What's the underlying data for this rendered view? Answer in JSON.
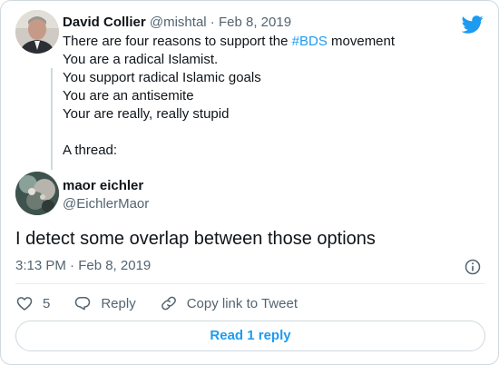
{
  "parent_tweet": {
    "author_name": "David Collier",
    "author_handle": "@mishtal",
    "separator": "·",
    "date": "Feb 8, 2019",
    "lines": [
      {
        "before": "There are four reasons to support the ",
        "hashtag": "#BDS",
        "after": " movement"
      },
      {
        "text": "You are a radical Islamist."
      },
      {
        "text": "You support radical Islamic goals"
      },
      {
        "text": "You are an antisemite"
      },
      {
        "text": "Your are really, really stupid"
      },
      {
        "text": ""
      },
      {
        "text": "A thread:"
      }
    ]
  },
  "main_tweet": {
    "author_name": "maor eichler",
    "author_handle": "@EichlerMaor",
    "text": "I detect some overlap between those options",
    "timestamp": "3:13 PM · Feb 8, 2019"
  },
  "actions": {
    "like_count": "5",
    "reply_label": "Reply",
    "copy_link_label": "Copy link to Tweet"
  },
  "read_replies_label": "Read 1 reply",
  "colors": {
    "accent": "#1d9bf0",
    "text": "#0f1419",
    "muted": "#536471",
    "border": "#cfd9de"
  },
  "icons": [
    "twitter-bird-icon",
    "info-icon",
    "heart-icon",
    "reply-icon",
    "link-icon"
  ]
}
